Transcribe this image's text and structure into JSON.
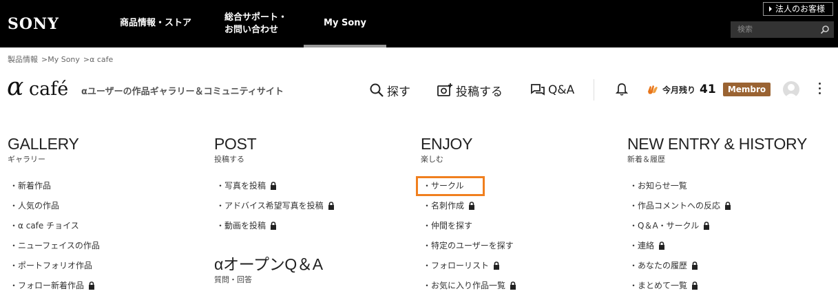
{
  "topbar": {
    "logo": "SONY",
    "nav": {
      "products": "商品情報・ストア",
      "support_line1": "総合サポート・",
      "support_line2": "お問い合わせ",
      "mysony": "My Sony"
    },
    "corporate_label": "法人のお客様",
    "search_placeholder": "検索"
  },
  "breadcrumb": [
    "製品情報",
    "My Sony",
    "α cafe"
  ],
  "breadcrumb_sep": ">",
  "header": {
    "logo_alpha": "α",
    "logo_text": "café",
    "tagline": "αユーザーの作品ギャラリー＆コミュニティサイト",
    "search_label": "探す",
    "post_label": "投稿する",
    "qa_label": "Q&A",
    "remaining_label": "今月残り",
    "remaining_count": "41",
    "membro_label": "Membro"
  },
  "columns": {
    "gallery": {
      "title": "GALLERY",
      "subtitle": "ギャラリー",
      "items": [
        {
          "label": "新着作品",
          "locked": false
        },
        {
          "label": "人気の作品",
          "locked": false
        },
        {
          "label": "α cafe チョイス",
          "locked": false
        },
        {
          "label": "ニューフェイスの作品",
          "locked": false
        },
        {
          "label": "ポートフォリオ作品",
          "locked": false
        },
        {
          "label": "フォロー新着作品",
          "locked": true
        }
      ]
    },
    "post": {
      "title": "POST",
      "subtitle": "投稿する",
      "items": [
        {
          "label": "写真を投稿",
          "locked": true
        },
        {
          "label": "アドバイス希望写真を投稿",
          "locked": true
        },
        {
          "label": "動画を投稿",
          "locked": true
        }
      ],
      "open_qa_title": "αオープンQ＆A",
      "open_qa_subtitle": "質問・回答"
    },
    "enjoy": {
      "title": "ENJOY",
      "subtitle": "楽しむ",
      "items": [
        {
          "label": "サークル",
          "locked": false
        },
        {
          "label": "名刺作成",
          "locked": true
        },
        {
          "label": "仲間を探す",
          "locked": false
        },
        {
          "label": "特定のユーザーを探す",
          "locked": false
        },
        {
          "label": "フォローリスト",
          "locked": true
        },
        {
          "label": "お気に入り作品一覧",
          "locked": true
        }
      ]
    },
    "new_entry": {
      "title": "NEW ENTRY & HISTORY",
      "subtitle": "新着＆履歴",
      "items": [
        {
          "label": "お知らせ一覧",
          "locked": false
        },
        {
          "label": "作品コメントへの反応",
          "locked": true
        },
        {
          "label": "Q＆A・サークル",
          "locked": true
        },
        {
          "label": "連絡",
          "locked": true
        },
        {
          "label": "あなたの履歴",
          "locked": true
        },
        {
          "label": "まとめて一覧",
          "locked": true
        }
      ]
    }
  },
  "bullet": "・",
  "colors": {
    "topbar_bg": "#000000",
    "membro_bg": "#9a6332",
    "highlight": "#f07f1e"
  },
  "icons": [
    "search-icon",
    "camera-plus-icon",
    "chat-icon",
    "bell-icon",
    "hands-icon",
    "lock-icon",
    "kebab-icon",
    "avatar"
  ]
}
